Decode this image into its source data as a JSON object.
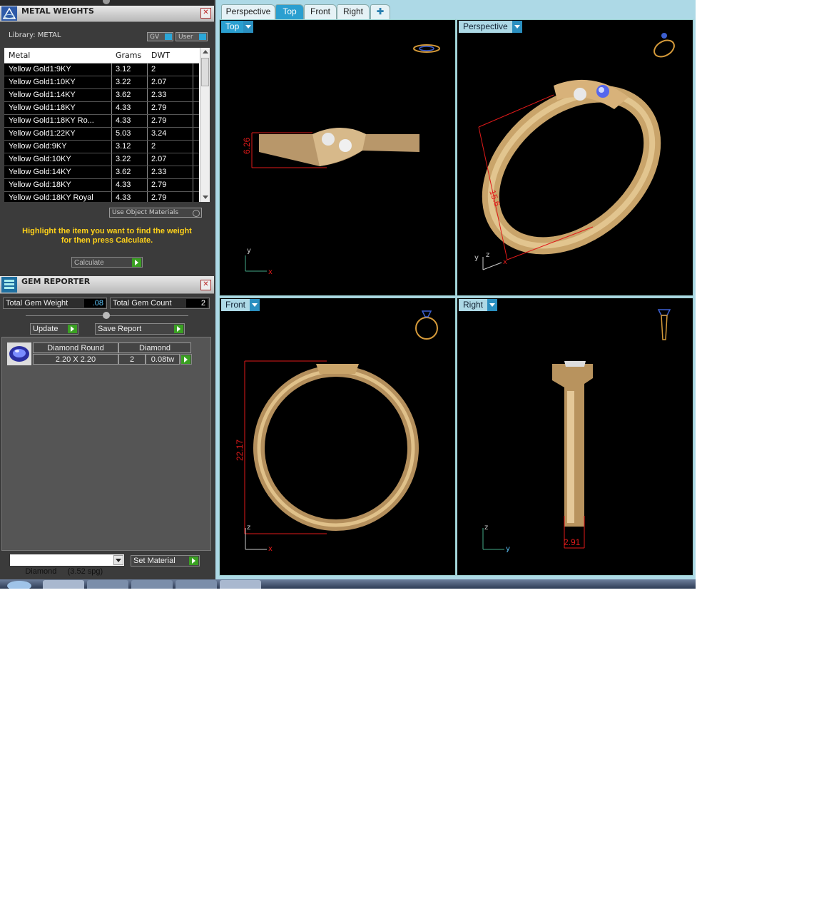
{
  "metal_weights": {
    "title": "METAL WEIGHTS",
    "library_label": "Library: METAL",
    "toggle_gv": "GV",
    "toggle_user": "User",
    "columns": [
      "Metal",
      "Grams",
      "DWT"
    ],
    "rows": [
      [
        "Yellow Gold1:9KY",
        "3.12",
        "2"
      ],
      [
        "Yellow Gold1:10KY",
        "3.22",
        "2.07"
      ],
      [
        "Yellow Gold1:14KY",
        "3.62",
        "2.33"
      ],
      [
        "Yellow Gold1:18KY",
        "4.33",
        "2.79"
      ],
      [
        "Yellow Gold1:18KY Ro...",
        "4.33",
        "2.79"
      ],
      [
        "Yellow Gold1:22KY",
        "5.03",
        "3.24"
      ],
      [
        "Yellow Gold:9KY",
        "3.12",
        "2"
      ],
      [
        "Yellow Gold:10KY",
        "3.22",
        "2.07"
      ],
      [
        "Yellow Gold:14KY",
        "3.62",
        "2.33"
      ],
      [
        "Yellow Gold:18KY",
        "4.33",
        "2.79"
      ],
      [
        "Yellow Gold:18KY Royal",
        "4.33",
        "2.79"
      ]
    ],
    "use_object_materials": "Use Object Materials",
    "hint_line1": "Highlight the item you want to find the weight",
    "hint_line2": "for then press Calculate.",
    "calculate_label": "Calculate"
  },
  "gem_reporter": {
    "title": "GEM REPORTER",
    "total_weight_label": "Total Gem Weight",
    "total_weight_value": ".08",
    "total_count_label": "Total Gem Count",
    "total_count_value": "2",
    "update_label": "Update",
    "save_report_label": "Save Report",
    "gem": {
      "shape": "Diamond Round",
      "size": "2.20 X 2.20",
      "material": "Diamond",
      "count": "2",
      "weight": "0.08tw"
    },
    "material_select": "Diamond     (3.52 spg)",
    "set_material_label": "Set Material"
  },
  "viewport_tabs": [
    "Perspective",
    "Top",
    "Front",
    "Right"
  ],
  "viewports": {
    "top": {
      "label": "Top",
      "dimension": "6.26",
      "axis_v": "y",
      "axis_h": "x"
    },
    "perspective": {
      "label": "Perspective",
      "dimension": "15.6",
      "axis_1": "y",
      "axis_2": "z",
      "axis_3": "x"
    },
    "front": {
      "label": "Front",
      "dimension": "22.17",
      "axis_v": "z",
      "axis_h": "x"
    },
    "right": {
      "label": "Right",
      "dimension": "2.91",
      "axis_v": "z",
      "axis_h": "y"
    }
  },
  "colors": {
    "gold": "#c9a46a",
    "dimension": "#e01a1a",
    "accent": "#2a9fd0",
    "hint": "#ffd21a"
  }
}
